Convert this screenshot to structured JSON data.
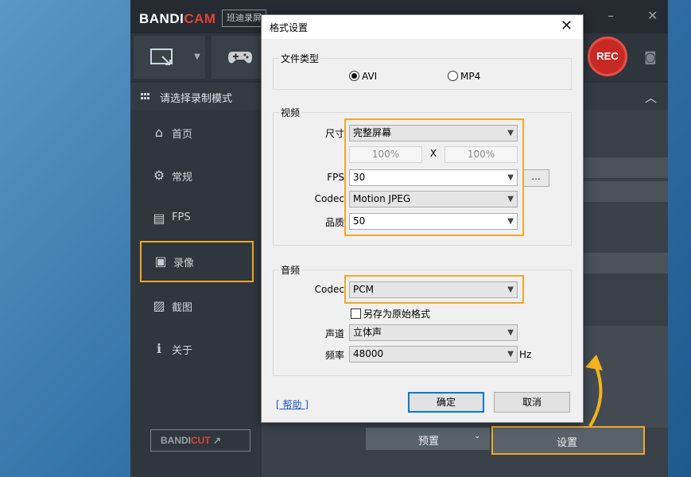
{
  "app": {
    "logo_main": "BANDI",
    "logo_accent": "CAM",
    "edition_label": "班迪录屏",
    "rec_label": "REC",
    "header_label": "请选择录制模式",
    "bandicut_main": "BANDI",
    "bandicut_accent": "CUT",
    "bandicut_arrow": "↗",
    "minimize_glyph": "–",
    "close_glyph": "✕"
  },
  "sidebar": {
    "items": [
      {
        "label": "首页",
        "icon": "home-icon",
        "glyph": "⌂"
      },
      {
        "label": "常规",
        "icon": "gear-icon",
        "glyph": "⚙"
      },
      {
        "label": "FPS",
        "icon": "fps-icon",
        "glyph": "▤"
      },
      {
        "label": "录像",
        "icon": "video-record-icon",
        "glyph": "▣",
        "active": true
      },
      {
        "label": "截图",
        "icon": "screenshot-icon",
        "glyph": "▨"
      },
      {
        "label": "关于",
        "icon": "info-icon",
        "glyph": "ℹ"
      }
    ]
  },
  "bottom": {
    "preset_label": "预置",
    "preset_caret": "⌄",
    "settings_label": "设置"
  },
  "dialog": {
    "title": "格式设置",
    "close_glyph": "✕",
    "file_type": {
      "group_label": "文件类型",
      "options": [
        "AVI",
        "MP4"
      ],
      "selected": "AVI"
    },
    "video": {
      "group_label": "视频",
      "size_label": "尺寸",
      "size_value": "完整屏幕",
      "width_pct": "100%",
      "cross": "X",
      "height_pct": "100%",
      "fps_label": "FPS",
      "fps_value": "30",
      "fps_more": "...",
      "codec_label": "Codec",
      "codec_value": "Motion JPEG",
      "quality_label": "品质",
      "quality_value": "50"
    },
    "audio": {
      "group_label": "音频",
      "codec_label": "Codec",
      "codec_value": "PCM",
      "save_original_label": "另存为原始格式",
      "channel_label": "声道",
      "channel_value": "立体声",
      "rate_label": "频率",
      "rate_value": "48000",
      "rate_unit": "Hz"
    },
    "help_label": "[ 帮助 ]",
    "ok_label": "确定",
    "cancel_label": "取消"
  },
  "colors": {
    "highlight": "#f0a826",
    "rec": "#c72a24",
    "link": "#1c56c8"
  }
}
